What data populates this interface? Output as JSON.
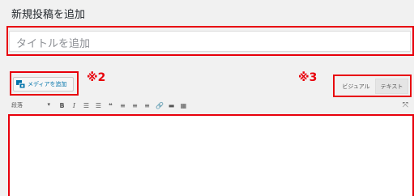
{
  "page": {
    "title": "新規投稿を追加"
  },
  "post": {
    "title_placeholder": "タイトルを追加",
    "content": ""
  },
  "media": {
    "add_label": "メディアを追加"
  },
  "annotations": {
    "mark2": "※2",
    "mark3": "※3",
    "color": "#e8000b"
  },
  "editor": {
    "tabs": [
      {
        "label": "ビジュアル"
      },
      {
        "label": "テキスト"
      }
    ],
    "format_select": {
      "value": "段落"
    },
    "toolbar": [
      "bold-icon",
      "italic-icon",
      "bulleted-list-icon",
      "numbered-list-icon",
      "blockquote-icon",
      "align-left-icon",
      "align-center-icon",
      "align-right-icon",
      "link-icon",
      "read-more-icon",
      "toolbar-toggle-icon",
      "fullscreen-icon"
    ]
  },
  "colors": {
    "link": "#0073aa",
    "background": "#f1f1f1"
  }
}
